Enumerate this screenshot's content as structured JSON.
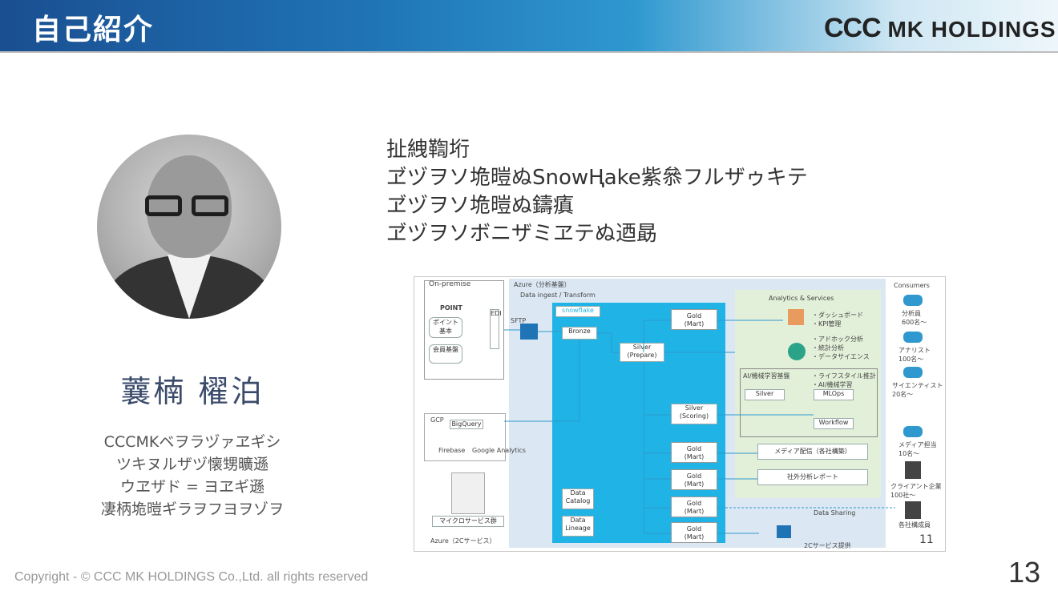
{
  "header": {
    "title": "自己紹介",
    "logo_ccc": "CCC",
    "logo_rest": "MK HOLDINGS"
  },
  "profile": {
    "name": "蘘楠 櫂泊",
    "lines": [
      "CCCMKベヲラヅァヱギシ",
      "ツキヌルザヅ懐甥曠遜",
      "ウヱザド = ヨヱギ遜",
      "凄柄垝暟ギラヲフヨヲゾヲ"
    ]
  },
  "bullets": [
    "扯絏鞫垳",
    "ヹヅヲソ垝暟ぬSnowⱧake紫叅フルザゥキテ",
    "ヹヅヲソ垝暟ぬ鑄瘨",
    "ヹヅヲソボニザミヱテぬ迺勗"
  ],
  "diagram": {
    "onprem_label": "On-premise",
    "point_label": "POINT",
    "azure_label": "Azure（分析基盤）",
    "ingest_label": "Data ingest / Transform",
    "snowflake_label": "snowflake",
    "bronze": "Bronze",
    "silver_prepare": "Silver\n(Prepare)",
    "silver_scoring": "Silver\n(Scoring)",
    "gold_mart": "Gold\n(Mart)",
    "analytics_label": "Analytics & Services",
    "ml_label": "AI/機械学習基盤",
    "svc_items_1": "・ダッシュボード\n・KPI管理",
    "svc_items_2": "・アドホック分析\n・統計分析\n・データサイエンス",
    "svc_items_3": "・ライフスタイル推計\n・AI/機械学習",
    "silver_small": "Silver",
    "mlops": "MLOps",
    "workflow": "Workflow",
    "media_report": "メディア配信（各社構築）",
    "external_report": "社外分析レポート",
    "data_sharing": "Data Sharing",
    "gcp_label": "GCP",
    "bigquery": "BigQuery",
    "firebase": "Firebase",
    "google_analytics": "Google Analytics",
    "point_box": "ポイント\n基本",
    "member_box": "会員基盤",
    "service_box": "マイクロサービス群",
    "azure_bottom": "Azure（2Cサービス）",
    "sftp": "SFTP",
    "data_catalog": "Data\nCatalog",
    "data_lineage": "Data\nLineage",
    "consumers_label": "Consumers",
    "consumer_1": "分析員\n600名〜",
    "consumer_2": "アナリスト\n100名〜",
    "consumer_3": "サイエンティスト\n20名〜",
    "consumer_4": "メディア担当\n10名〜",
    "consumer_5": "クライアント企業\n100社〜",
    "consumer_6": "各社構成員",
    "svc_provide": "2Cサービス提供",
    "slide_no": "11"
  },
  "footer": {
    "copyright": "Copyright - © CCC MK HOLDINGS Co.,Ltd. all rights reserved",
    "page": "13"
  }
}
